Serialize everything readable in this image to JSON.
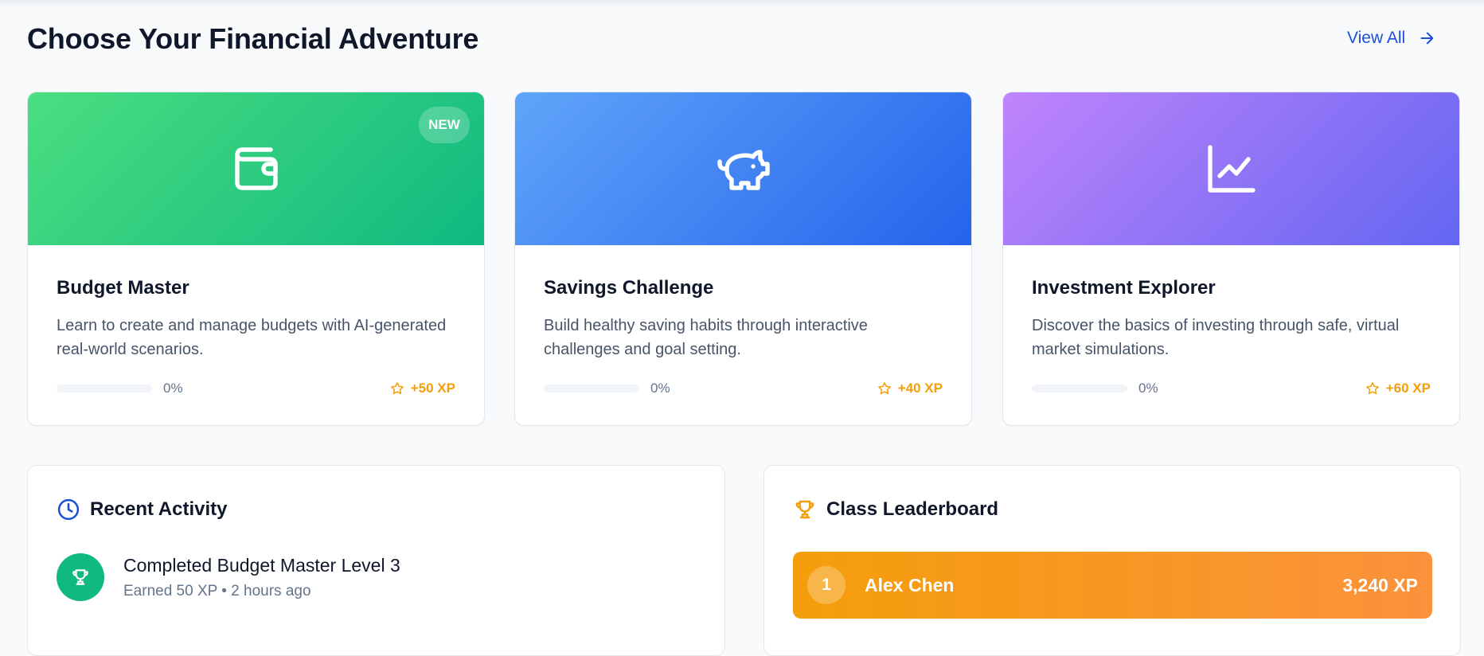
{
  "header": {
    "title": "Choose Your Financial Adventure",
    "view_all_label": "View All",
    "view_all_icon": "arrow-right-icon",
    "accent_color": "#1d4ed8"
  },
  "modules": [
    {
      "title": "Budget Master",
      "description": "Learn to create and manage budgets with AI-generated real-world scenarios.",
      "icon": "wallet-icon",
      "badge": "NEW",
      "progress": 0,
      "progress_label": "0%",
      "xp_label": "+50 XP",
      "gradient": [
        "#4ade80",
        "#10b981"
      ]
    },
    {
      "title": "Savings Challenge",
      "description": "Build healthy saving habits through interactive challenges and goal setting.",
      "icon": "piggy-bank-icon",
      "badge": "",
      "progress": 0,
      "progress_label": "0%",
      "xp_label": "+40 XP",
      "gradient": [
        "#60a5fa",
        "#2563eb"
      ]
    },
    {
      "title": "Investment Explorer",
      "description": "Discover the basics of investing through safe, virtual market simulations.",
      "icon": "chart-line-icon",
      "badge": "",
      "progress": 0,
      "progress_label": "0%",
      "xp_label": "+60 XP",
      "gradient": [
        "#c084fc",
        "#6366f1"
      ]
    }
  ],
  "recent_activity": {
    "title": "Recent Activity",
    "icon": "clock-icon",
    "items": [
      {
        "icon": "trophy-icon",
        "title": "Completed Budget Master Level 3",
        "meta": "Earned 50 XP • 2 hours ago",
        "color": "#10b981"
      }
    ]
  },
  "leaderboard": {
    "title": "Class Leaderboard",
    "icon": "trophy-icon",
    "entries": [
      {
        "rank": "1",
        "name": "Alex Chen",
        "xp": "3,240 XP"
      }
    ]
  },
  "colors": {
    "xp": "#f59e0b",
    "leader_gradient": [
      "#f59e0b",
      "#fb923c"
    ]
  }
}
